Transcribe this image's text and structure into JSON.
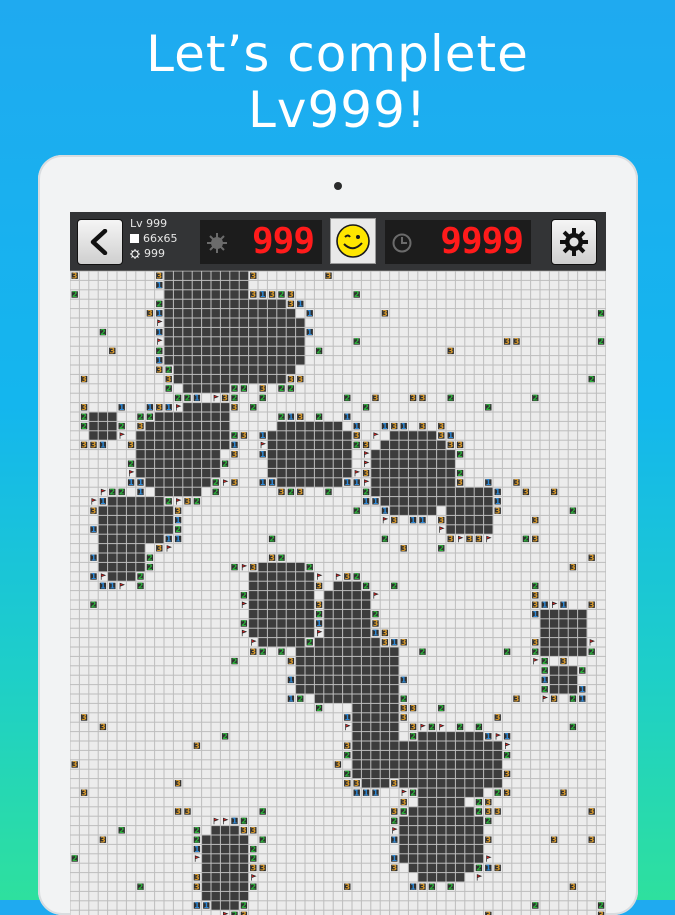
{
  "headline": {
    "line1": "Let’s complete",
    "line2": "Lv999!"
  },
  "toolbar": {
    "back_icon": "back-arrow-icon",
    "level": "Lv 999",
    "board_size": "66x65",
    "mine_total": "999",
    "mines_left": "999",
    "smiley_icon": "winking-smiley-icon",
    "timer": "9999",
    "settings_icon": "gear-icon"
  },
  "colors": {
    "digit_red": "#ff1b1b",
    "cell_light": "#ececec",
    "cell_dark": "#3c3c3c",
    "n1": "#2e89d6",
    "n2": "#2bb13a",
    "n3": "#d99a2b",
    "n4": "#e3582c"
  }
}
